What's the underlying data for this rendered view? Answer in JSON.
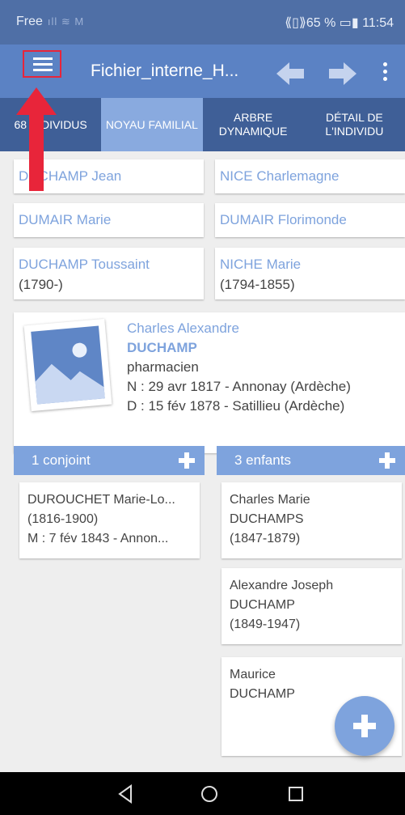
{
  "status_bar": {
    "carrier": "Free",
    "signal_icons": "ıll ≋ M",
    "right": "⟪▯⟫65 % ▭▮ 11:54"
  },
  "toolbar": {
    "title": "Fichier_interne_H..."
  },
  "tabs": [
    "68 INDIVIDUS",
    "NOYAU FAMILIAL",
    "ARBRE DYNAMIQUE",
    "DÉTAIL DE L'INDIVIDU"
  ],
  "parents": {
    "father": "DUCHAMP Jean",
    "mother_side_father": "NICE Charlemagne",
    "father_mother": "DUMAIR Marie",
    "mother_mother": "DUMAIR Florimonde",
    "father_name": "DUCHAMP Toussaint",
    "father_years": "(1790-)",
    "mother_name": "NICHE Marie",
    "mother_years": "(1794-1855)"
  },
  "person": {
    "first_names": "Charles Alexandre",
    "surname": "DUCHAMP",
    "occupation": "pharmacien",
    "birth": "N : 29 avr 1817 - Annonay (Ardèche)",
    "death": "D : 15 fév 1878 - Satillieu (Ardèche)"
  },
  "spouses": {
    "header": "1 conjoint",
    "items": [
      {
        "name": "DUROUCHET Marie-Lo...",
        "years": "(1816-1900)",
        "marriage": "M : 7 fév 1843 - Annon..."
      }
    ]
  },
  "children": {
    "header": "3 enfants",
    "items": [
      {
        "line1": "Charles Marie",
        "line2": "DUCHAMPS",
        "line3": "(1847-1879)"
      },
      {
        "line1": "Alexandre Joseph",
        "line2": "DUCHAMP",
        "line3": "(1849-1947)"
      },
      {
        "line1": "Maurice",
        "line2": "DUCHAMP",
        "line3": ""
      }
    ]
  },
  "colors": {
    "toolbar": "#5b82c4",
    "tabs": "#3f5f97",
    "accent": "#7ea3dd",
    "annotation": "#e8253a"
  }
}
